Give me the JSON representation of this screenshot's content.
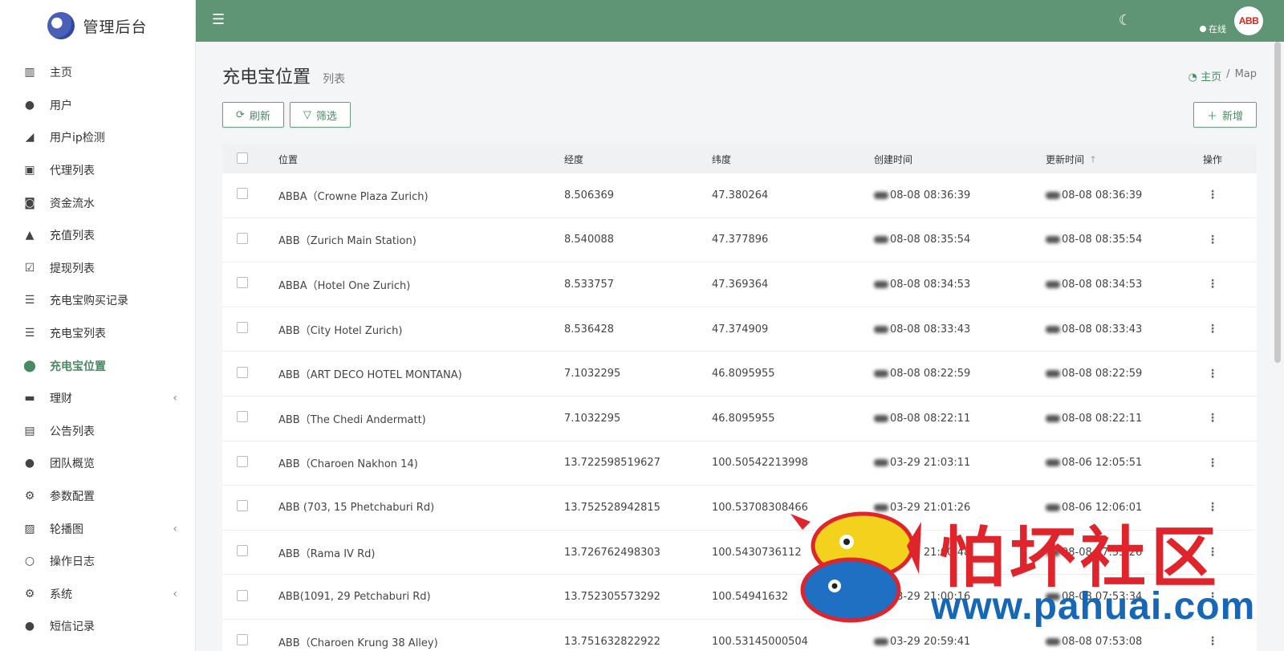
{
  "brand": {
    "title": "管理后台"
  },
  "sidebar": {
    "items": [
      {
        "label": "主页",
        "icon": "bar-chart-icon",
        "glyph": "▥",
        "active": false,
        "chevron": false
      },
      {
        "label": "用户",
        "icon": "user-icon",
        "glyph": "●",
        "active": false,
        "chevron": false
      },
      {
        "label": "用户ip检测",
        "icon": "signal-icon",
        "glyph": "◢",
        "active": false,
        "chevron": false
      },
      {
        "label": "代理列表",
        "icon": "contact-icon",
        "glyph": "▣",
        "active": false,
        "chevron": false
      },
      {
        "label": "资金流水",
        "icon": "money-icon",
        "glyph": "◙",
        "active": false,
        "chevron": false
      },
      {
        "label": "充值列表",
        "icon": "recharge-icon",
        "glyph": "▲",
        "active": false,
        "chevron": false
      },
      {
        "label": "提现列表",
        "icon": "check-square-icon",
        "glyph": "☑",
        "active": false,
        "chevron": false
      },
      {
        "label": "充电宝购买记录",
        "icon": "list-icon",
        "glyph": "☰",
        "active": false,
        "chevron": false
      },
      {
        "label": "充电宝列表",
        "icon": "indent-list-icon",
        "glyph": "☰",
        "active": false,
        "chevron": false
      },
      {
        "label": "充电宝位置",
        "icon": "map-pin-icon",
        "glyph": "⬤",
        "active": true,
        "chevron": false
      },
      {
        "label": "理财",
        "icon": "archive-icon",
        "glyph": "▬",
        "active": false,
        "chevron": true
      },
      {
        "label": "公告列表",
        "icon": "file-text-icon",
        "glyph": "▤",
        "active": false,
        "chevron": false
      },
      {
        "label": "团队概览",
        "icon": "users-icon",
        "glyph": "●",
        "active": false,
        "chevron": false
      },
      {
        "label": "参数配置",
        "icon": "cogs-icon",
        "glyph": "⚙",
        "active": false,
        "chevron": false
      },
      {
        "label": "轮播图",
        "icon": "image-icon",
        "glyph": "▨",
        "active": false,
        "chevron": true
      },
      {
        "label": "操作日志",
        "icon": "circle-icon",
        "glyph": "○",
        "active": false,
        "chevron": false
      },
      {
        "label": "系统",
        "icon": "gear-icon",
        "glyph": "⚙",
        "active": false,
        "chevron": true
      },
      {
        "label": "短信记录",
        "icon": "comment-icon",
        "glyph": "●",
        "active": false,
        "chevron": false
      }
    ]
  },
  "header": {
    "status": "在线",
    "avatar_text": "ABB"
  },
  "page": {
    "title": "充电宝位置",
    "subtitle": "列表"
  },
  "breadcrumb": {
    "home": "主页",
    "current": "Map"
  },
  "toolbar": {
    "refresh": "刷新",
    "filter": "筛选",
    "add": "新增"
  },
  "table": {
    "headers": {
      "position": "位置",
      "lng": "经度",
      "lat": "纬度",
      "created": "创建时间",
      "updated": "更新时间",
      "ops": "操作"
    },
    "rows": [
      {
        "position": "ABBA（Crowne Plaza Zurich)",
        "lng": "8.506369",
        "lat": "47.380264",
        "created": "08-08 08:36:39",
        "updated": "08-08 08:36:39"
      },
      {
        "position": "ABB（Zurich Main Station)",
        "lng": "8.540088",
        "lat": "47.377896",
        "created": "08-08 08:35:54",
        "updated": "08-08 08:35:54"
      },
      {
        "position": "ABBA（Hotel One Zurich)",
        "lng": "8.533757",
        "lat": "47.369364",
        "created": "08-08 08:34:53",
        "updated": "08-08 08:34:53"
      },
      {
        "position": "ABB（City Hotel Zurich)",
        "lng": "8.536428",
        "lat": "47.374909",
        "created": "08-08 08:33:43",
        "updated": "08-08 08:33:43"
      },
      {
        "position": "ABB（ART DECO HOTEL MONTANA)",
        "lng": "7.1032295",
        "lat": "46.8095955",
        "created": "08-08 08:22:59",
        "updated": "08-08 08:22:59"
      },
      {
        "position": "ABB（The Chedi Andermatt)",
        "lng": "7.1032295",
        "lat": "46.8095955",
        "created": "08-08 08:22:11",
        "updated": "08-08 08:22:11"
      },
      {
        "position": "ABB（Charoen Nakhon 14)",
        "lng": "13.722598519627",
        "lat": "100.50542213998",
        "created": "03-29 21:03:11",
        "updated": "08-06 12:05:51"
      },
      {
        "position": "ABB (703, 15 Phetchaburi Rd)",
        "lng": "13.752528942815",
        "lat": "100.53708308466",
        "created": "03-29 21:01:26",
        "updated": "08-06 12:06:01"
      },
      {
        "position": "ABB（Rama IV Rd)",
        "lng": "13.726762498303",
        "lat": "100.5430736112",
        "created": "03-29 21:00:48",
        "updated": "08-08 07:53:26"
      },
      {
        "position": "ABB(1091, 29 Petchaburi Rd)",
        "lng": "13.752305573292",
        "lat": "100.54941632",
        "created": "03-29 21:00:16",
        "updated": "08-08 07:53:34"
      },
      {
        "position": "ABB（Charoen Krung 38 Alley)",
        "lng": "13.751632822922",
        "lat": "100.53145000504",
        "created": "03-29 20:59:41",
        "updated": "08-08 07:53:08"
      }
    ]
  },
  "watermark": {
    "text": "怕坏社区",
    "url": "www.pahuai.com"
  },
  "colors": {
    "header": "#5f9474",
    "accent": "#4a8a62",
    "watermark_red": "#e0242c",
    "watermark_blue": "#1667b6"
  }
}
